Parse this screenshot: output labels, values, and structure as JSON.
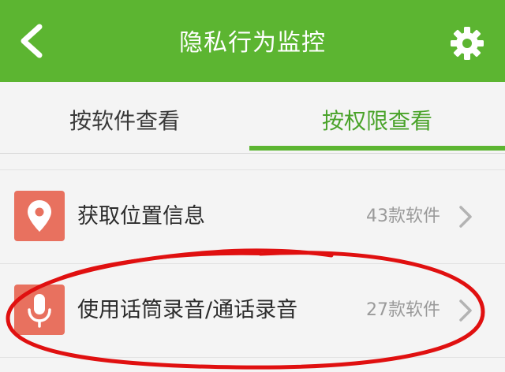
{
  "header": {
    "title": "隐私行为监控",
    "back_icon": "chevron-left-icon",
    "settings_icon": "gear-icon",
    "background_color": "#5cb531"
  },
  "tabs": [
    {
      "label": "按软件查看",
      "selected": false
    },
    {
      "label": "按权限查看",
      "selected": true
    }
  ],
  "list": {
    "items": [
      {
        "label": "获取位置信息",
        "count": "43款软件",
        "icon": "location-pin-icon"
      },
      {
        "label": "使用话筒录音/通话录音",
        "count": "27款软件",
        "icon": "microphone-icon"
      }
    ]
  },
  "colors": {
    "accent": "#5cb531",
    "icon_background": "#e8715f",
    "annotation_circle": "#e01010"
  }
}
